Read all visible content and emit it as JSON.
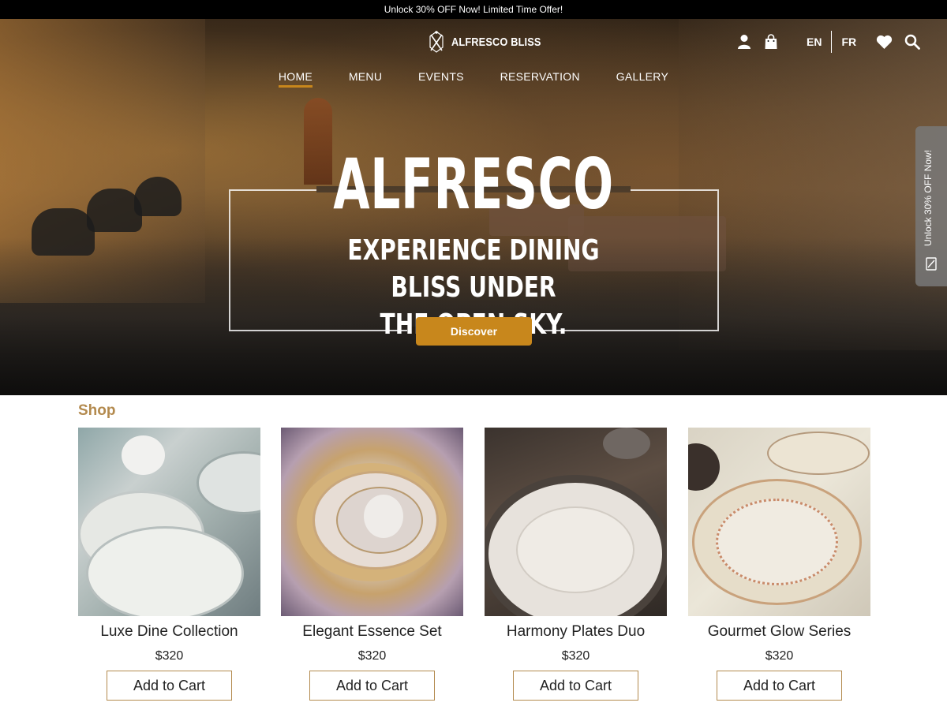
{
  "promo": {
    "text": "Unlock 30% OFF Now! Limited Time Offer!"
  },
  "brand": {
    "name": "ALFRESCO BLISS"
  },
  "header": {
    "languages": [
      "EN",
      "FR"
    ],
    "icons": [
      "user-icon",
      "shopping-bag-icon",
      "heart-icon",
      "search-icon"
    ]
  },
  "nav": {
    "items": [
      {
        "label": "HOME",
        "active": true
      },
      {
        "label": "MENU"
      },
      {
        "label": "EVENTS"
      },
      {
        "label": "RESERVATION"
      },
      {
        "label": "GALLERY"
      }
    ]
  },
  "hero": {
    "title": "ALFRESCO",
    "subtitle_line1": "EXPERIENCE DINING BLISS UNDER",
    "subtitle_line2": "THE OPEN SKY.",
    "cta_label": "Discover"
  },
  "side_tab": {
    "text": "Unlock 30% OFF Now!"
  },
  "shop": {
    "title": "Shop",
    "products": [
      {
        "name": "Luxe Dine Collection",
        "price": "$320",
        "button": "Add to Cart"
      },
      {
        "name": "Elegant Essence Set",
        "price": "$320",
        "button": "Add to Cart"
      },
      {
        "name": "Harmony Plates Duo",
        "price": "$320",
        "button": "Add to Cart"
      },
      {
        "name": "Gourmet Glow Series",
        "price": "$320",
        "button": "Add to Cart"
      }
    ]
  },
  "colors": {
    "accent": "#c8871c",
    "shop_title": "#b38a4e",
    "promo_bg": "#000000"
  }
}
